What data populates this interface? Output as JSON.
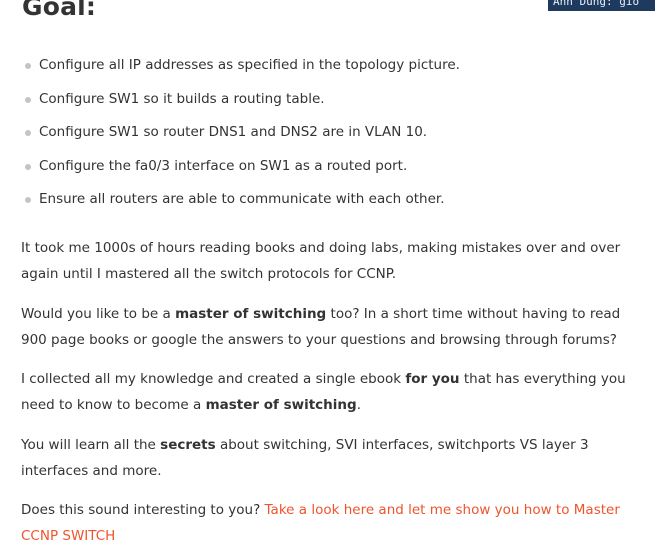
{
  "heading": "Goal:",
  "badge_text": "Anh Dung: gio",
  "goals": [
    "Configure all IP addresses as specified in the topology picture.",
    "Configure SW1 so it builds a routing table.",
    "Configure SW1 so router DNS1 and DNS2 are in VLAN 10.",
    "Configure the fa0/3 interface on SW1 as a routed port.",
    "Ensure all routers are able to communicate with each other."
  ],
  "p1": {
    "text": "It took me 1000s of hours reading books and doing labs, making mistakes over and over again until I mastered all the switch protocols for CCNP."
  },
  "p2": {
    "a": "Would you like to be a ",
    "b": "master of switching",
    "c": " too? In a short time without having to read 900 page books or google the answers to your questions and browsing through forums?"
  },
  "p3": {
    "a": "I collected all my knowledge and created a single ebook ",
    "b": "for you",
    "c": " that has everything you need to know to become a ",
    "d": "master of switching",
    "e": "."
  },
  "p4": {
    "a": "You will learn all the ",
    "b": "secrets",
    "c": " about switching, SVI interfaces, switchports VS layer 3 interfaces and more."
  },
  "p5": {
    "a": "Does this sound interesting to you? ",
    "link": "Take a look here and let me show you how to Master CCNP SWITCH"
  },
  "colors": {
    "text": "#333333",
    "link": "#f0542c",
    "bullet": "#c4c4c4",
    "badge_bg": "#1f3a5f"
  }
}
